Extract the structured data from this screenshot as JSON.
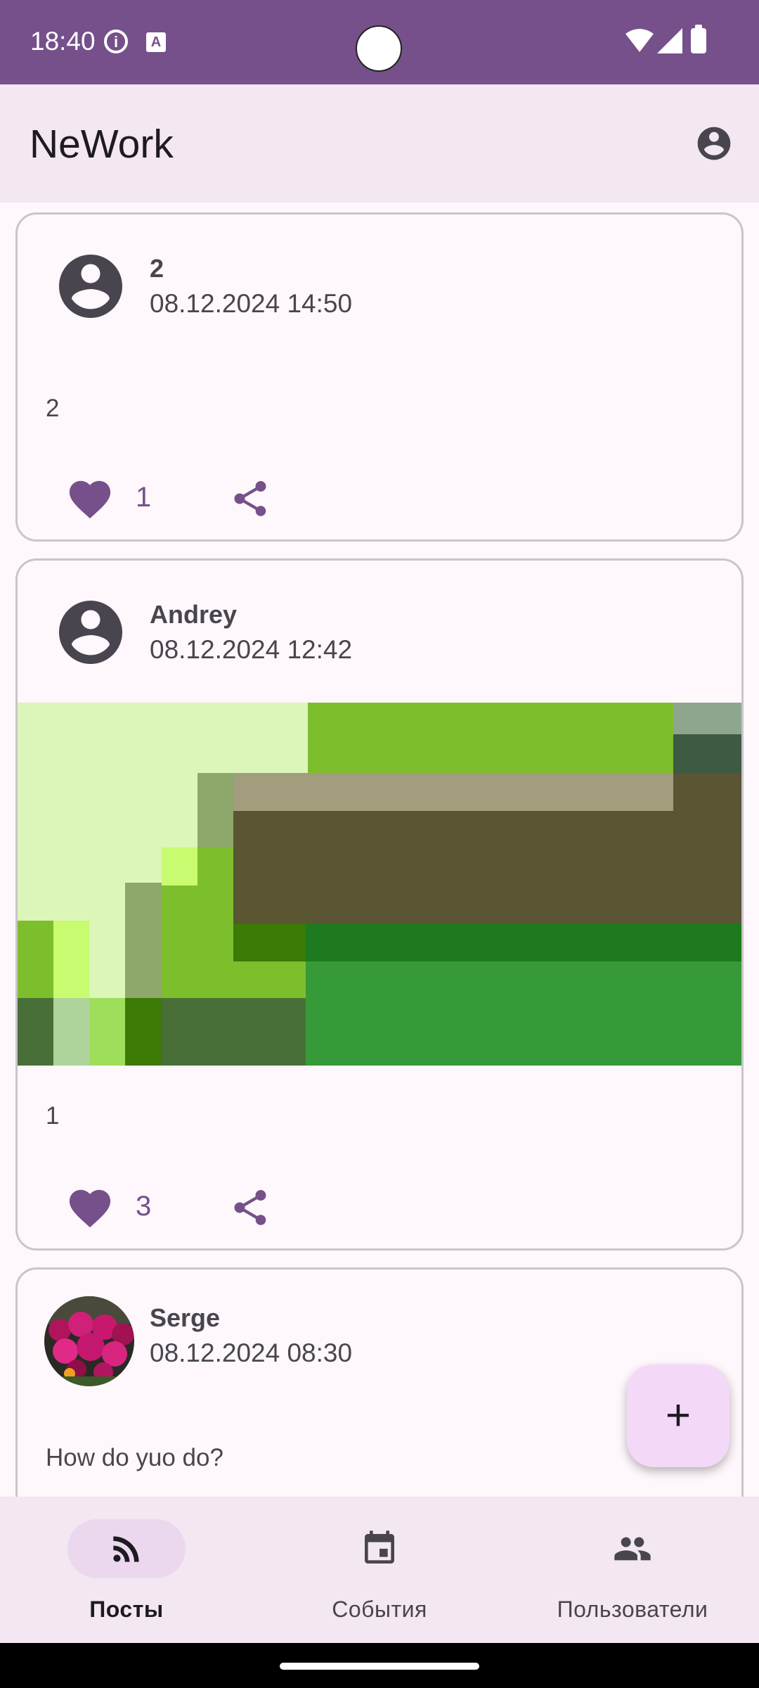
{
  "status_bar": {
    "time": "18:40",
    "icons": [
      "info-icon",
      "keyboard-a-icon",
      "wifi-icon",
      "signal-icon",
      "battery-icon"
    ]
  },
  "app_bar": {
    "title": "NeWork",
    "account_icon": "account-circle-icon"
  },
  "posts": [
    {
      "author": "2",
      "published": "08.12.2024 14:50",
      "content": "2",
      "likes": "1",
      "avatar": "default-avatar-icon",
      "has_image": false
    },
    {
      "author": "Andrey",
      "published": "08.12.2024 12:42",
      "content": "1",
      "likes": "3",
      "avatar": "default-avatar-icon",
      "has_image": true
    },
    {
      "author": "Serge",
      "published": "08.12.2024 08:30",
      "content": "How do yuo do?",
      "avatar": "photo-avatar",
      "has_image": false
    }
  ],
  "fab": {
    "label": "+"
  },
  "bottom_nav": {
    "items": [
      {
        "label": "Посты",
        "icon": "rss-feed-icon",
        "active": true
      },
      {
        "label": "События",
        "icon": "calendar-icon",
        "active": false
      },
      {
        "label": "Пользователи",
        "icon": "people-icon",
        "active": false
      }
    ]
  },
  "colors": {
    "primary": "#75508A",
    "surface": "#FEF7FB",
    "app_bar": "#F3E7F1",
    "fab": "#F3D9F7",
    "nav_active_pill": "#EBD8EF",
    "border": "#C9C5CA"
  }
}
